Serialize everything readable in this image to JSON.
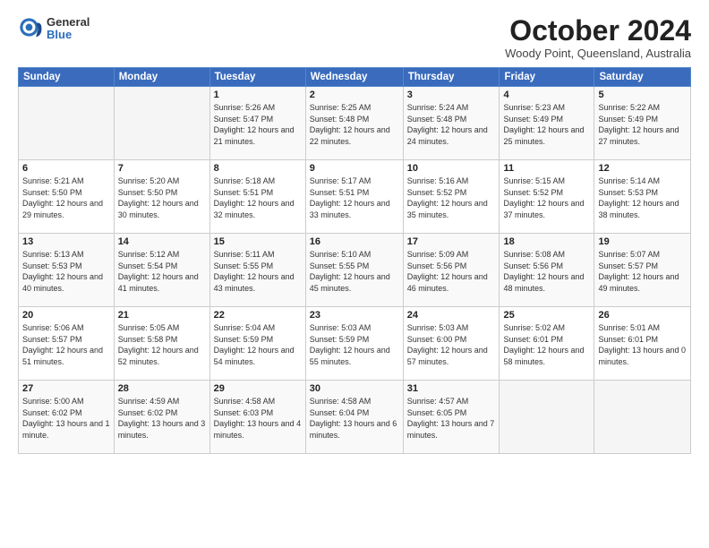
{
  "logo": {
    "general": "General",
    "blue": "Blue"
  },
  "header": {
    "month": "October 2024",
    "location": "Woody Point, Queensland, Australia"
  },
  "days_of_week": [
    "Sunday",
    "Monday",
    "Tuesday",
    "Wednesday",
    "Thursday",
    "Friday",
    "Saturday"
  ],
  "weeks": [
    [
      {
        "day": "",
        "empty": true
      },
      {
        "day": "",
        "empty": true
      },
      {
        "day": "1",
        "sunrise": "5:26 AM",
        "sunset": "5:47 PM",
        "daylight": "12 hours and 21 minutes."
      },
      {
        "day": "2",
        "sunrise": "5:25 AM",
        "sunset": "5:48 PM",
        "daylight": "12 hours and 22 minutes."
      },
      {
        "day": "3",
        "sunrise": "5:24 AM",
        "sunset": "5:48 PM",
        "daylight": "12 hours and 24 minutes."
      },
      {
        "day": "4",
        "sunrise": "5:23 AM",
        "sunset": "5:49 PM",
        "daylight": "12 hours and 25 minutes."
      },
      {
        "day": "5",
        "sunrise": "5:22 AM",
        "sunset": "5:49 PM",
        "daylight": "12 hours and 27 minutes."
      }
    ],
    [
      {
        "day": "6",
        "sunrise": "5:21 AM",
        "sunset": "5:50 PM",
        "daylight": "12 hours and 29 minutes."
      },
      {
        "day": "7",
        "sunrise": "5:20 AM",
        "sunset": "5:50 PM",
        "daylight": "12 hours and 30 minutes."
      },
      {
        "day": "8",
        "sunrise": "5:18 AM",
        "sunset": "5:51 PM",
        "daylight": "12 hours and 32 minutes."
      },
      {
        "day": "9",
        "sunrise": "5:17 AM",
        "sunset": "5:51 PM",
        "daylight": "12 hours and 33 minutes."
      },
      {
        "day": "10",
        "sunrise": "5:16 AM",
        "sunset": "5:52 PM",
        "daylight": "12 hours and 35 minutes."
      },
      {
        "day": "11",
        "sunrise": "5:15 AM",
        "sunset": "5:52 PM",
        "daylight": "12 hours and 37 minutes."
      },
      {
        "day": "12",
        "sunrise": "5:14 AM",
        "sunset": "5:53 PM",
        "daylight": "12 hours and 38 minutes."
      }
    ],
    [
      {
        "day": "13",
        "sunrise": "5:13 AM",
        "sunset": "5:53 PM",
        "daylight": "12 hours and 40 minutes."
      },
      {
        "day": "14",
        "sunrise": "5:12 AM",
        "sunset": "5:54 PM",
        "daylight": "12 hours and 41 minutes."
      },
      {
        "day": "15",
        "sunrise": "5:11 AM",
        "sunset": "5:55 PM",
        "daylight": "12 hours and 43 minutes."
      },
      {
        "day": "16",
        "sunrise": "5:10 AM",
        "sunset": "5:55 PM",
        "daylight": "12 hours and 45 minutes."
      },
      {
        "day": "17",
        "sunrise": "5:09 AM",
        "sunset": "5:56 PM",
        "daylight": "12 hours and 46 minutes."
      },
      {
        "day": "18",
        "sunrise": "5:08 AM",
        "sunset": "5:56 PM",
        "daylight": "12 hours and 48 minutes."
      },
      {
        "day": "19",
        "sunrise": "5:07 AM",
        "sunset": "5:57 PM",
        "daylight": "12 hours and 49 minutes."
      }
    ],
    [
      {
        "day": "20",
        "sunrise": "5:06 AM",
        "sunset": "5:57 PM",
        "daylight": "12 hours and 51 minutes."
      },
      {
        "day": "21",
        "sunrise": "5:05 AM",
        "sunset": "5:58 PM",
        "daylight": "12 hours and 52 minutes."
      },
      {
        "day": "22",
        "sunrise": "5:04 AM",
        "sunset": "5:59 PM",
        "daylight": "12 hours and 54 minutes."
      },
      {
        "day": "23",
        "sunrise": "5:03 AM",
        "sunset": "5:59 PM",
        "daylight": "12 hours and 55 minutes."
      },
      {
        "day": "24",
        "sunrise": "5:03 AM",
        "sunset": "6:00 PM",
        "daylight": "12 hours and 57 minutes."
      },
      {
        "day": "25",
        "sunrise": "5:02 AM",
        "sunset": "6:01 PM",
        "daylight": "12 hours and 58 minutes."
      },
      {
        "day": "26",
        "sunrise": "5:01 AM",
        "sunset": "6:01 PM",
        "daylight": "13 hours and 0 minutes."
      }
    ],
    [
      {
        "day": "27",
        "sunrise": "5:00 AM",
        "sunset": "6:02 PM",
        "daylight": "13 hours and 1 minute."
      },
      {
        "day": "28",
        "sunrise": "4:59 AM",
        "sunset": "6:02 PM",
        "daylight": "13 hours and 3 minutes."
      },
      {
        "day": "29",
        "sunrise": "4:58 AM",
        "sunset": "6:03 PM",
        "daylight": "13 hours and 4 minutes."
      },
      {
        "day": "30",
        "sunrise": "4:58 AM",
        "sunset": "6:04 PM",
        "daylight": "13 hours and 6 minutes."
      },
      {
        "day": "31",
        "sunrise": "4:57 AM",
        "sunset": "6:05 PM",
        "daylight": "13 hours and 7 minutes."
      },
      {
        "day": "",
        "empty": true
      },
      {
        "day": "",
        "empty": true
      }
    ]
  ]
}
